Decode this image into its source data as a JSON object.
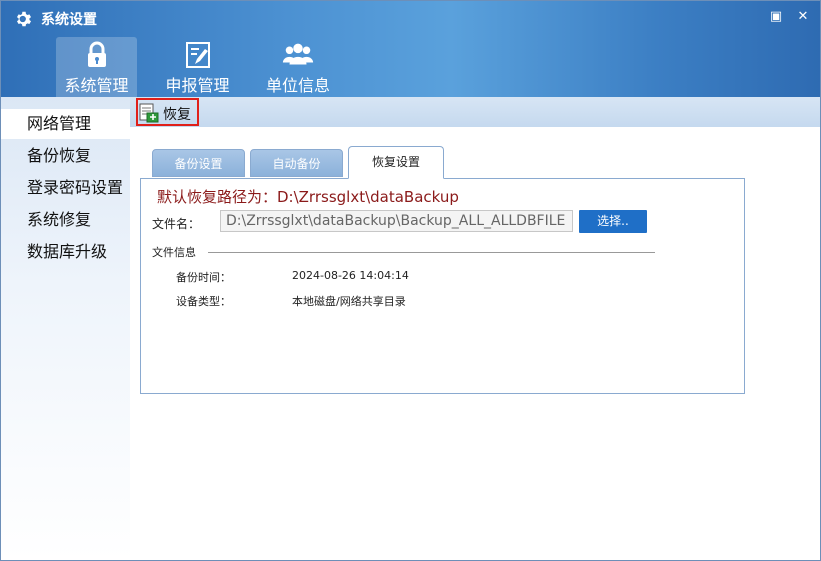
{
  "window": {
    "title": "系统设置",
    "maximize_symbol": "▣",
    "close_symbol": "✕"
  },
  "nav": {
    "items": [
      {
        "label": "系统管理",
        "icon": "lock-icon",
        "active": true
      },
      {
        "label": "申报管理",
        "icon": "edit-document-icon",
        "active": false
      },
      {
        "label": "单位信息",
        "icon": "users-icon",
        "active": false
      }
    ]
  },
  "sidebar": {
    "items": [
      {
        "label": "网络管理",
        "active": true
      },
      {
        "label": "备份恢复",
        "active": false
      },
      {
        "label": "登录密码设置",
        "active": false
      },
      {
        "label": "系统修复",
        "active": false
      },
      {
        "label": "数据库升级",
        "active": false
      }
    ]
  },
  "toolbar": {
    "restore_label": "恢复",
    "restore_icon": "restore-database-icon",
    "highlight_color": "#e0201a"
  },
  "tabs": [
    {
      "label": "备份设置",
      "active": false
    },
    {
      "label": "自动备份",
      "active": false
    },
    {
      "label": "恢复设置",
      "active": true
    }
  ],
  "restore": {
    "default_path": "默认恢复路径为：D:\\Zrrssglxt\\dataBackup",
    "filename_label": "文件名：",
    "filename_value": "D:\\Zrrssglxt\\dataBackup\\Backup_ALL_ALLDBFILE",
    "browse_label": "选择..",
    "file_info_label": "文件信息",
    "backup_time_label": "备份时间：",
    "backup_time_value": "2024-08-26 14:04:14",
    "device_type_label": "设备类型：",
    "device_type_value": "本地磁盘/网络共享目录"
  },
  "colors": {
    "header_blue": "#4c91d2",
    "button_blue": "#1f6fc7",
    "path_text": "#8b1a1a"
  }
}
